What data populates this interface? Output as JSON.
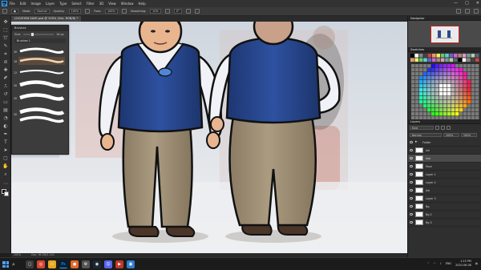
{
  "app": {
    "logo": "Ps"
  },
  "menu": [
    "File",
    "Edit",
    "Image",
    "Layer",
    "Type",
    "Select",
    "Filter",
    "3D",
    "View",
    "Window",
    "Help"
  ],
  "window_controls": [
    "—",
    "□",
    "✕"
  ],
  "options_bar": {
    "mode_label": "Mode:",
    "mode_value": "Normal",
    "opacity_label": "Opacity:",
    "opacity_value": "100%",
    "flow_label": "Flow:",
    "flow_value": "100%",
    "smoothing_label": "Smoothing:",
    "smoothing_value": "10%",
    "angle_value": "0°"
  },
  "document_tab": {
    "title": "LOCATION SAVE.psd @ 200% (line, RGB/8) *"
  },
  "brushes_panel": {
    "title": "Brushes",
    "size_label": "Size:",
    "size_value": "16 px",
    "folder_label": "Brushes 1",
    "brush_sizes": [
      30,
      18,
      12,
      30,
      30,
      30
    ]
  },
  "status_bar": {
    "zoom": "200%",
    "doc_size": "Doc: 36.2M/2.11G"
  },
  "navigator": {
    "title": "Navigator"
  },
  "swatches": {
    "title": "Swatches"
  },
  "layers": {
    "title": "Layers",
    "kind_filter": "Kind",
    "blend_mode": "Normal",
    "opacity": "100%",
    "fill": "100%",
    "rows": [
      {
        "name": "Folder",
        "type": "folder",
        "active": false
      },
      {
        "name": "Ink",
        "type": "layer",
        "active": false
      },
      {
        "name": "line",
        "type": "layer",
        "active": true
      },
      {
        "name": "Face",
        "type": "layer",
        "active": false
      },
      {
        "name": "Layer 1",
        "type": "layer",
        "active": false
      },
      {
        "name": "Layer 2",
        "type": "layer",
        "active": false
      },
      {
        "name": "Ink",
        "type": "layer",
        "active": false
      },
      {
        "name": "Layer 3",
        "type": "layer",
        "active": false
      },
      {
        "name": "Bg",
        "type": "layer",
        "active": false
      },
      {
        "name": "Bg 2",
        "type": "layer",
        "active": false
      },
      {
        "name": "Bg 3",
        "type": "layer",
        "active": false
      }
    ]
  },
  "taskbar": {
    "apps": [
      "chrome",
      "folder",
      "ps",
      "firefox",
      "settings",
      "steam",
      "discord",
      "media",
      "photos"
    ],
    "tray_lang": "ENG",
    "time": "1:25 PM",
    "date": "2020-06-08"
  },
  "colors": {
    "vest": "#2a4a8c",
    "vest_dark": "#1b3266",
    "shirt": "#f0f2f8",
    "pants": "#a29278",
    "pants_dark": "#7e6f59",
    "skin": "#e9b58f",
    "shoes": "#4a3528",
    "badge": "#4f86d6",
    "bg_room": "#d8dde4"
  }
}
